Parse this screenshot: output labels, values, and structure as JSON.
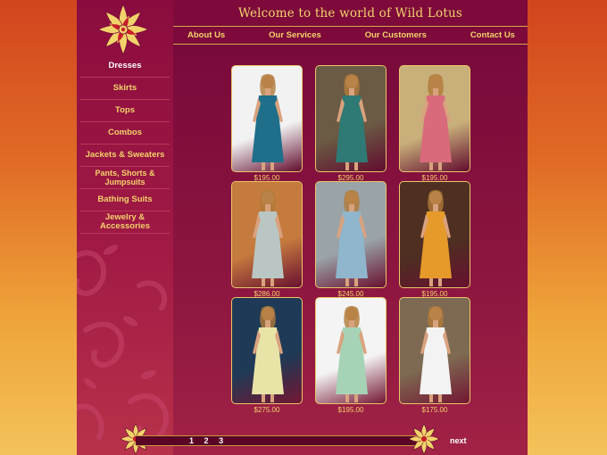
{
  "header": {
    "welcome": "Welcome to the world of Wild Lotus",
    "nav": [
      "About Us",
      "Our Services",
      "Our Customers",
      "Contact Us"
    ]
  },
  "sidebar": {
    "items": [
      {
        "label": "Dresses",
        "active": true
      },
      {
        "label": "Skirts"
      },
      {
        "label": "Tops"
      },
      {
        "label": "Combos"
      },
      {
        "label": "Jackets & Sweaters"
      },
      {
        "label": "Pants, Shorts & Jumpsuits"
      },
      {
        "label": "Bathing Suits"
      },
      {
        "label": "Jewelry & Accessories"
      }
    ]
  },
  "products": [
    {
      "price": "$195.00",
      "dress_color": "#1f6f8a",
      "bg": "#f2f2f2"
    },
    {
      "price": "$295.00",
      "dress_color": "#2f7a74",
      "bg": "#6b5a44"
    },
    {
      "price": "$195.00",
      "dress_color": "#d86a7c",
      "bg": "#c9b07a"
    },
    {
      "price": "$286.00",
      "dress_color": "#b9c6c4",
      "bg": "#c57a3e"
    },
    {
      "price": "$245.00",
      "dress_color": "#8fb6cc",
      "bg": "#9aa3a8"
    },
    {
      "price": "$195.00",
      "dress_color": "#e59a2a",
      "bg": "#4e2f22"
    },
    {
      "price": "$275.00",
      "dress_color": "#e8e4a8",
      "bg": "#1f3a56"
    },
    {
      "price": "$195.00",
      "dress_color": "#a6d3b6",
      "bg": "#f4f4f4"
    },
    {
      "price": "$175.00",
      "dress_color": "#f3f3f3",
      "bg": "#7e6a52"
    }
  ],
  "pager": {
    "pages": [
      "1",
      "2",
      "3"
    ],
    "next": "next"
  }
}
